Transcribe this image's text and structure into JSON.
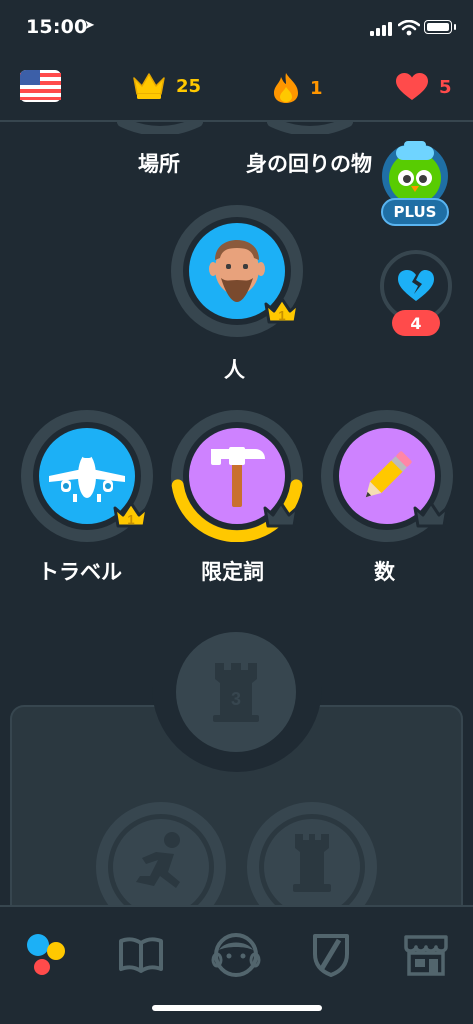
{
  "status_bar": {
    "time": "15:00"
  },
  "top_bar": {
    "language_flag": "us-flag-icon",
    "crowns": "25",
    "streak": "1",
    "hearts": "5"
  },
  "skills": {
    "place": {
      "label": "場所"
    },
    "belongings": {
      "label": "身の回りの物"
    },
    "person": {
      "label": "人",
      "crown_level": "1"
    },
    "travel": {
      "label": "トラベル",
      "crown_level": "1"
    },
    "determiners": {
      "label": "限定詞",
      "progress": 0.45
    },
    "numbers": {
      "label": "数"
    }
  },
  "side_widgets": {
    "plus_label": "PLUS",
    "broken_hearts_count": "4"
  },
  "checkpoint": {
    "number": "3"
  },
  "colors": {
    "background": "#1f2a33",
    "ring": "#37464f",
    "blue_skill": "#1cb0f6",
    "purple_skill": "#ce82ff",
    "gold": "#ffc800",
    "red": "#ff4b4b"
  },
  "bottom_nav": [
    "learn-icon",
    "stories-icon",
    "profile-icon",
    "leagues-icon",
    "shop-icon"
  ]
}
